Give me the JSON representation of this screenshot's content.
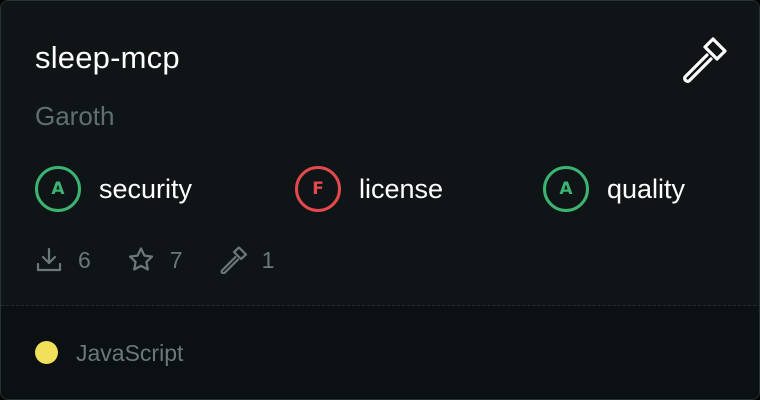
{
  "card": {
    "title": "sleep-mcp",
    "author": "Garoth",
    "action_icon": "hammer-icon"
  },
  "grades": [
    {
      "letter": "A",
      "label": "security",
      "status": "good"
    },
    {
      "letter": "F",
      "label": "license",
      "status": "bad"
    },
    {
      "letter": "A",
      "label": "quality",
      "status": "good"
    }
  ],
  "stats": {
    "downloads": "6",
    "stars": "7",
    "tools": "1"
  },
  "language": {
    "name": "JavaScript",
    "color": "#f1e05a"
  },
  "colors": {
    "grade_good": "#3cb371",
    "grade_bad": "#e5484d",
    "background": "#0f1517"
  }
}
